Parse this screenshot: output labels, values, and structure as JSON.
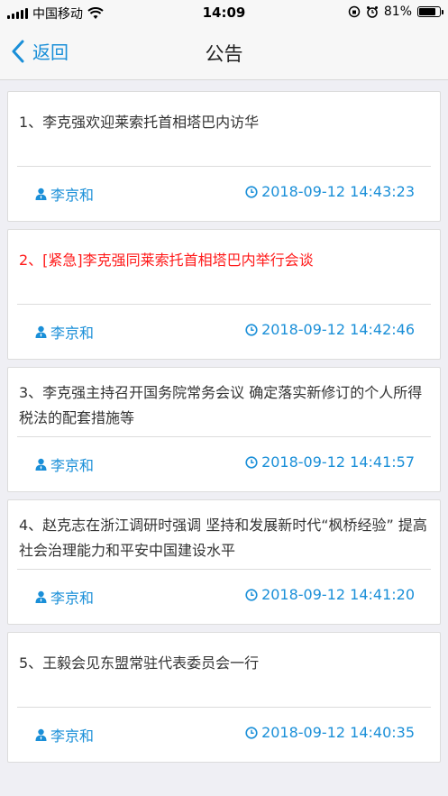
{
  "status_bar": {
    "carrier": "中国移动",
    "time": "14:09",
    "battery": "81%",
    "battery_level": 0.81
  },
  "nav": {
    "back_label": "返回",
    "title": "公告"
  },
  "announcements": [
    {
      "title": "1、李克强欢迎莱索托首相塔巴内访华",
      "author": "李京和",
      "time": "2018-09-12 14:43:23"
    },
    {
      "title": "2、[紧急]李克强同莱索托首相塔巴内举行会谈",
      "author": "李京和",
      "time": "2018-09-12 14:42:46"
    },
    {
      "title": "3、李克强主持召开国务院常务会议 确定落实新修订的个人所得税法的配套措施等",
      "author": "李京和",
      "time": "2018-09-12 14:41:57"
    },
    {
      "title": "4、赵克志在浙江调研时强调 坚持和发展新时代“枫桥经验” 提高社会治理能力和平安中国建设水平",
      "author": "李京和",
      "time": "2018-09-12 14:41:20"
    },
    {
      "title": "5、王毅会见东盟常驻代表委员会一行",
      "author": "李京和",
      "time": "2018-09-12 14:40:35"
    }
  ],
  "colors": {
    "accent": "#1a8fd8",
    "urgent": "#ff1a1a"
  }
}
